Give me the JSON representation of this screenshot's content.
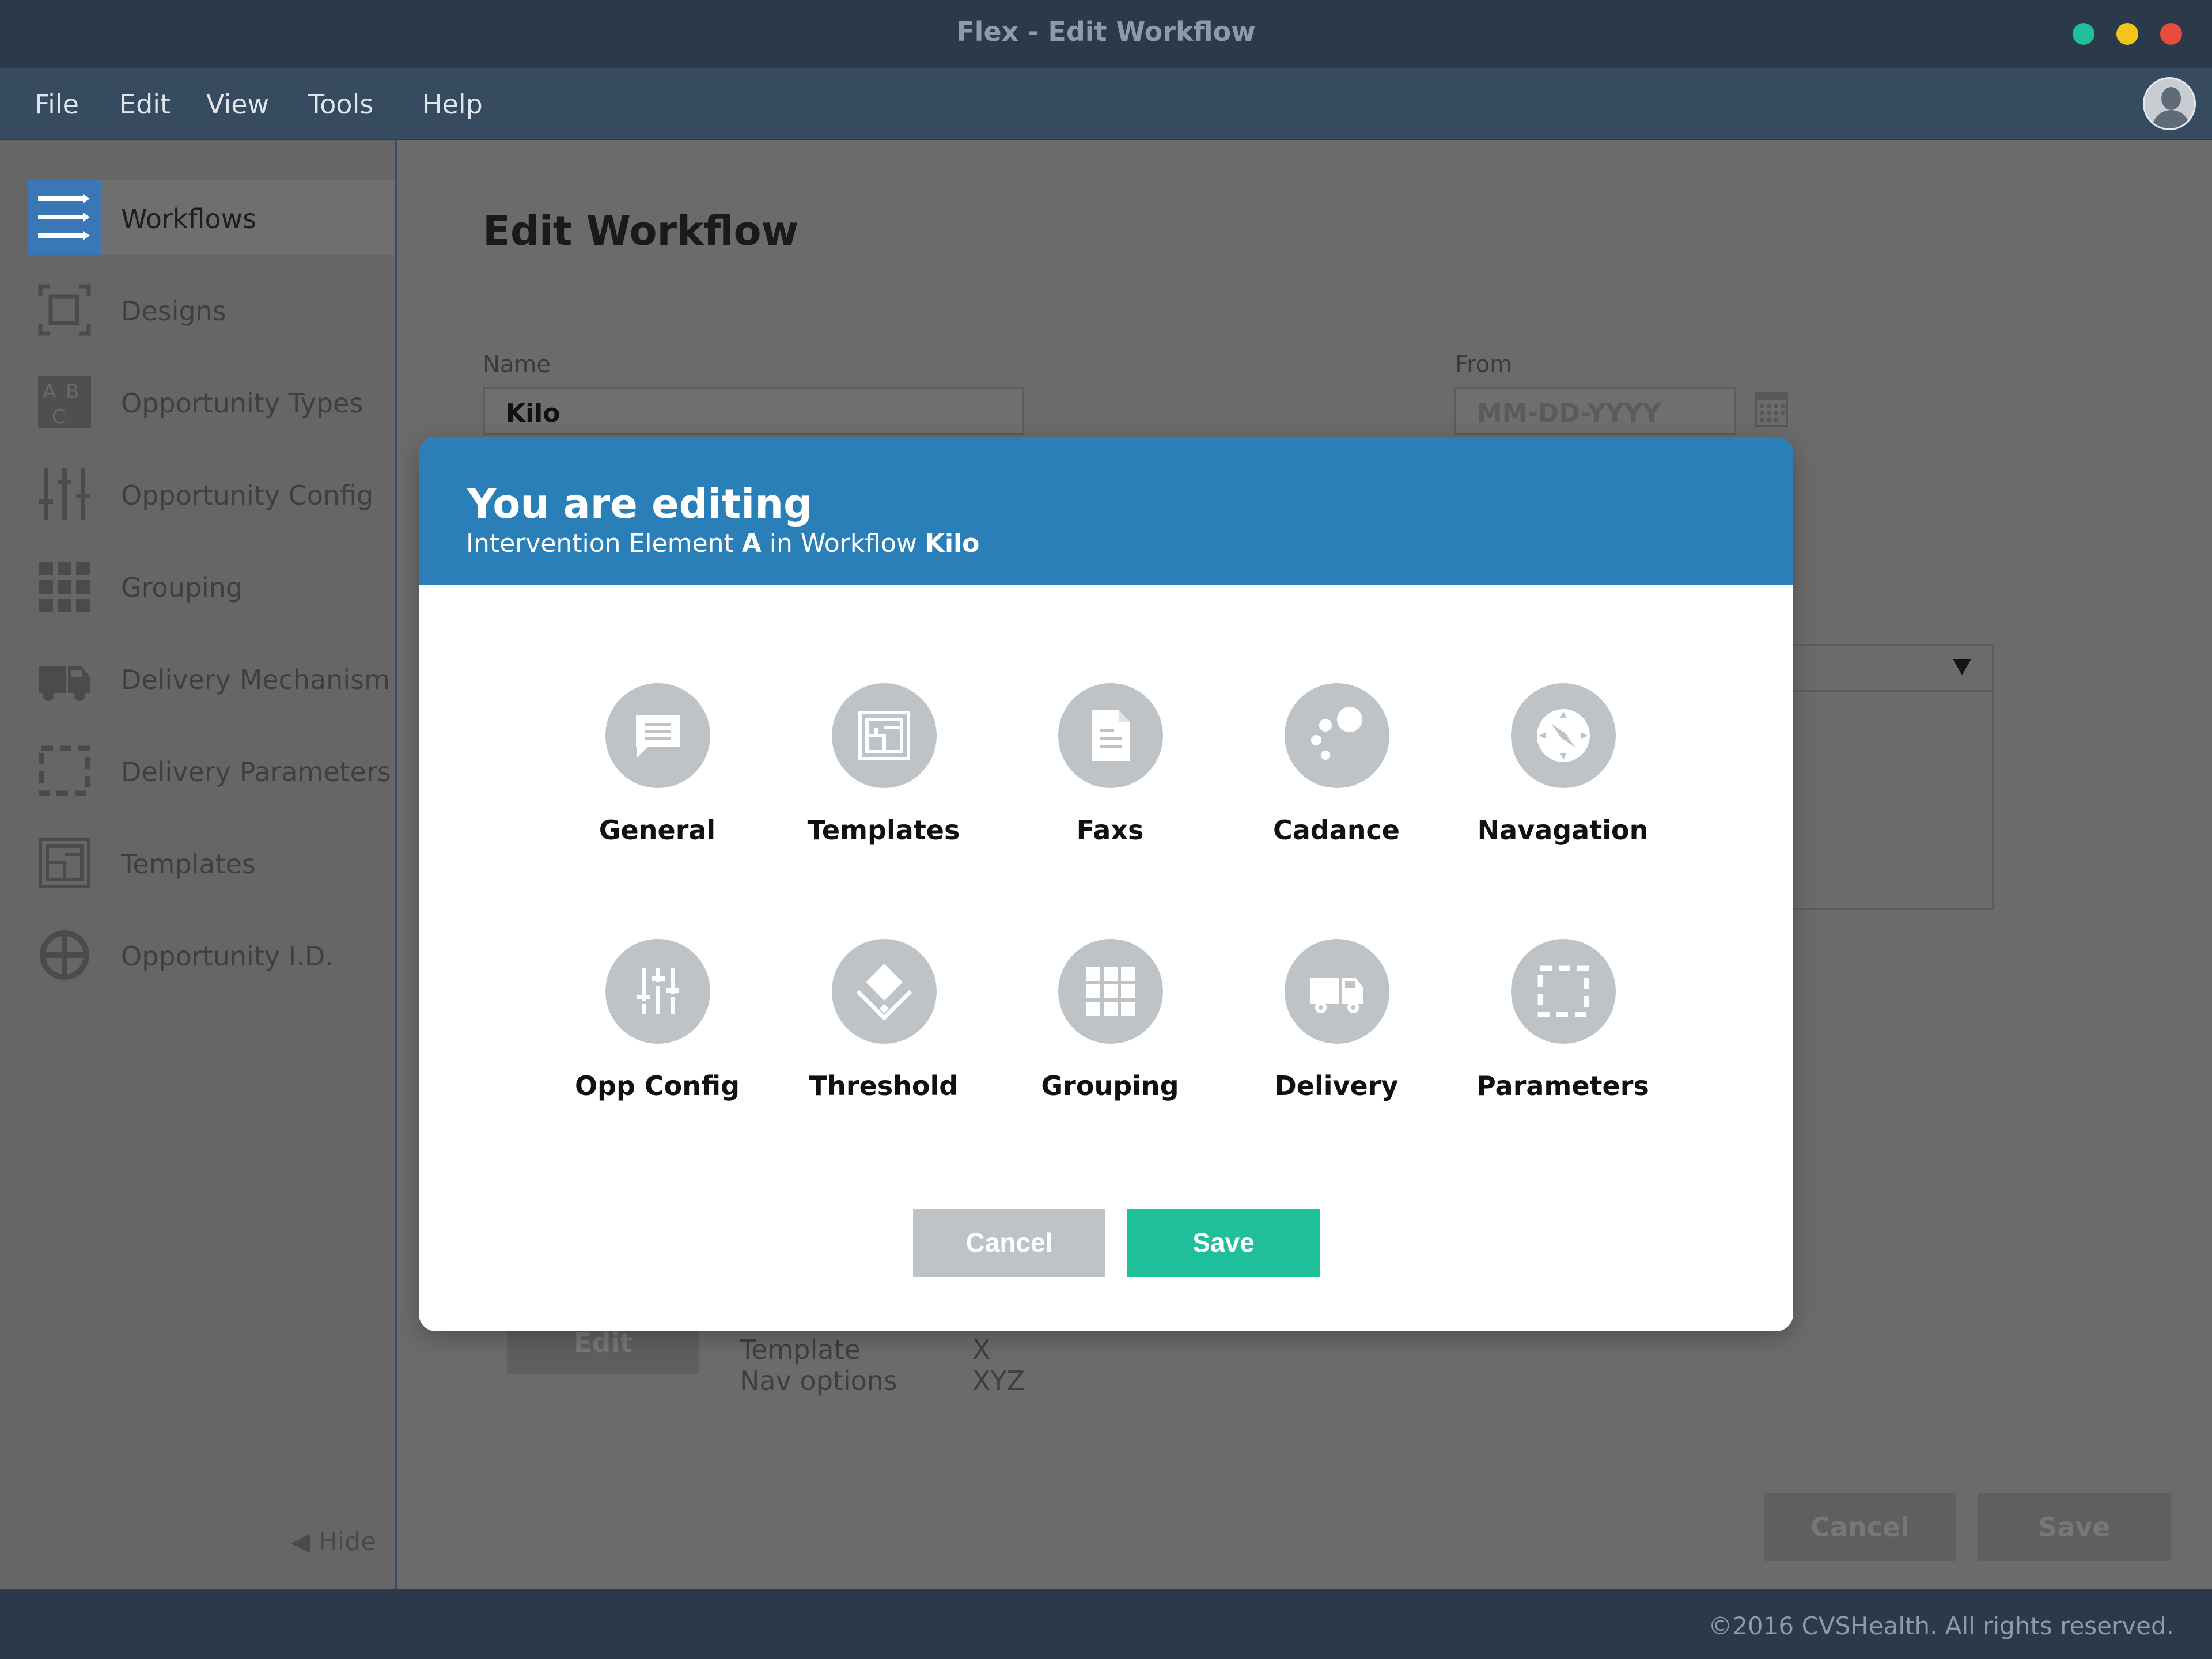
{
  "window": {
    "title": "Flex - Edit Workflow"
  },
  "menu": [
    "File",
    "Edit",
    "View",
    "Tools",
    "Help"
  ],
  "sidebar": {
    "items": [
      {
        "label": "Workflows",
        "icon": "workflows-icon",
        "active": true
      },
      {
        "label": "Designs",
        "icon": "designs-icon"
      },
      {
        "label": "Opportunity Types",
        "icon": "abc-icon"
      },
      {
        "label": "Opportunity Config",
        "icon": "sliders-icon"
      },
      {
        "label": "Grouping",
        "icon": "grid-icon"
      },
      {
        "label": "Delivery Mechanism",
        "icon": "truck-icon"
      },
      {
        "label": "Delivery Parameters",
        "icon": "dashed-square-icon"
      },
      {
        "label": "Templates",
        "icon": "templates-icon"
      },
      {
        "label": "Opportunity I.D.",
        "icon": "crosshair-icon"
      }
    ],
    "hide_label": "◀ Hide"
  },
  "main": {
    "title": "Edit Workflow",
    "name_label": "Name",
    "name_value": "Kilo",
    "from_label": "From",
    "from_placeholder": "MM-DD-YYYY",
    "edit_button": "Edit",
    "details": [
      {
        "key": "Template",
        "value": "X"
      },
      {
        "key": "Nav options",
        "value": "XYZ"
      }
    ],
    "cancel_button": "Cancel",
    "save_button": "Save"
  },
  "modal": {
    "title": "You are editing",
    "subtitle_prefix": "Intervention Element ",
    "element": "A",
    "subtitle_mid": " in Workflow ",
    "workflow": "Kilo",
    "options": [
      {
        "label": "General",
        "icon": "speech-bubble-icon"
      },
      {
        "label": "Templates",
        "icon": "templates-icon"
      },
      {
        "label": "Faxs",
        "icon": "document-icon"
      },
      {
        "label": "Cadance",
        "icon": "bubbles-icon"
      },
      {
        "label": "Navagation",
        "icon": "compass-icon"
      },
      {
        "label": "Opp Config",
        "icon": "sliders-icon"
      },
      {
        "label": "Threshold",
        "icon": "threshold-icon"
      },
      {
        "label": "Grouping",
        "icon": "grid-icon"
      },
      {
        "label": "Delivery",
        "icon": "truck-icon"
      },
      {
        "label": "Parameters",
        "icon": "dashed-square-icon"
      }
    ],
    "cancel_button": "Cancel",
    "save_button": "Save"
  },
  "footer": {
    "copyright": "©2016 CVSHealth. All rights reserved."
  },
  "colors": {
    "titlebar": "#2b3a4b",
    "menubar": "#364a60",
    "modal_header": "#2b7fb9",
    "accent_save": "#1fbf99",
    "icon_circle": "#bdc3c7"
  }
}
